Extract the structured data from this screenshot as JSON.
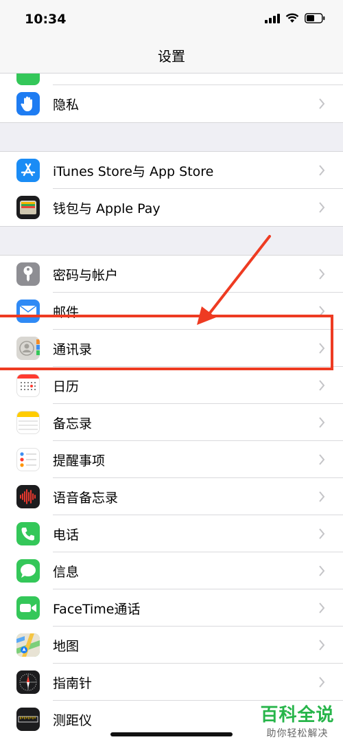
{
  "status": {
    "time": "10:34"
  },
  "nav": {
    "title": "设置"
  },
  "groups": [
    {
      "items": [
        {
          "label": "隐私",
          "icon": "hand-icon",
          "color": "#1e7cf2"
        }
      ]
    },
    {
      "items": [
        {
          "label": "iTunes Store与 App Store",
          "icon": "app-store-icon",
          "color": "#1a8cf5"
        },
        {
          "label": "钱包与 Apple Pay",
          "icon": "wallet-icon",
          "color": "#1c1c1e"
        }
      ]
    },
    {
      "items": [
        {
          "label": "密码与帐户",
          "icon": "key-icon",
          "color": "#8e8e93"
        },
        {
          "label": "邮件",
          "icon": "mail-icon",
          "color": "#2f8af5"
        },
        {
          "label": "通讯录",
          "icon": "contacts-icon",
          "color": "#d9d7d2"
        },
        {
          "label": "日历",
          "icon": "calendar-icon",
          "color": "#ffffff"
        },
        {
          "label": "备忘录",
          "icon": "notes-icon",
          "color": "#ffffff"
        },
        {
          "label": "提醒事项",
          "icon": "reminders-icon",
          "color": "#ffffff"
        },
        {
          "label": "语音备忘录",
          "icon": "voice-memos-icon",
          "color": "#1c1c1e"
        },
        {
          "label": "电话",
          "icon": "phone-icon",
          "color": "#34c759"
        },
        {
          "label": "信息",
          "icon": "messages-icon",
          "color": "#34c759"
        },
        {
          "label": "FaceTime通话",
          "icon": "facetime-icon",
          "color": "#34c759"
        },
        {
          "label": "地图",
          "icon": "maps-icon",
          "color": "#7ccf7a"
        },
        {
          "label": "指南针",
          "icon": "compass-icon",
          "color": "#1c1c1e"
        },
        {
          "label": "测距仪",
          "icon": "measure-icon",
          "color": "#1c1c1e"
        }
      ]
    }
  ],
  "watermark": {
    "main": "百科全说",
    "sub": "助你轻松解决"
  },
  "colors": {
    "annotation": "#ee3b22",
    "background": "#efeff4"
  }
}
